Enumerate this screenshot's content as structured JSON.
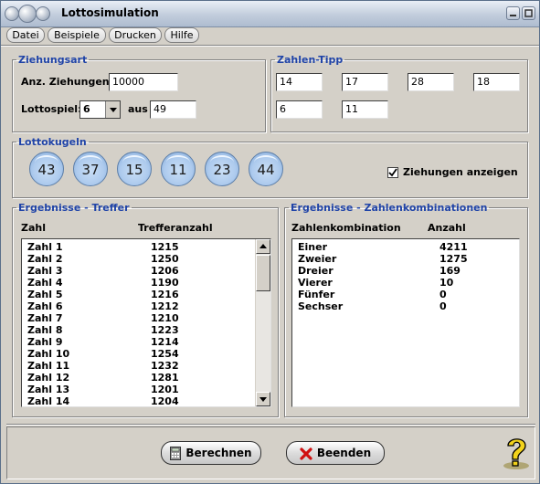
{
  "window": {
    "title": "Lottosimulation"
  },
  "menu": {
    "items": [
      "Datei",
      "Beispiele",
      "Drucken",
      "Hilfe"
    ]
  },
  "ziehungsart": {
    "legend": "Ziehungsart",
    "anz_label": "Anz. Ziehungen:",
    "anz_value": "10000",
    "lottospiel_label": "Lottospiel:",
    "lottospiel_value": "6",
    "aus_label": "aus",
    "aus_value": "49"
  },
  "tipp": {
    "legend": "Zahlen-Tipp",
    "values": [
      "14",
      "17",
      "28",
      "18",
      "6",
      "11"
    ]
  },
  "kugeln": {
    "legend": "Lottokugeln",
    "balls": [
      "43",
      "37",
      "15",
      "11",
      "23",
      "44"
    ],
    "show_label": "Ziehungen anzeigen",
    "show_checked": true
  },
  "treffer": {
    "legend": "Ergebnisse - Treffer",
    "col1": "Zahl",
    "col2": "Trefferanzahl",
    "rows": [
      [
        "Zahl 1",
        "1215"
      ],
      [
        "Zahl 2",
        "1250"
      ],
      [
        "Zahl 3",
        "1206"
      ],
      [
        "Zahl 4",
        "1190"
      ],
      [
        "Zahl 5",
        "1216"
      ],
      [
        "Zahl 6",
        "1212"
      ],
      [
        "Zahl 7",
        "1210"
      ],
      [
        "Zahl 8",
        "1223"
      ],
      [
        "Zahl 9",
        "1214"
      ],
      [
        "Zahl 10",
        "1254"
      ],
      [
        "Zahl 11",
        "1232"
      ],
      [
        "Zahl 12",
        "1281"
      ],
      [
        "Zahl 13",
        "1201"
      ],
      [
        "Zahl 14",
        "1204"
      ]
    ]
  },
  "kombi": {
    "legend": "Ergebnisse - Zahlenkombinationen",
    "col1": "Zahlenkombination",
    "col2": "Anzahl",
    "rows": [
      [
        "Einer",
        "4211"
      ],
      [
        "Zweier",
        "1275"
      ],
      [
        "Dreier",
        "169"
      ],
      [
        "Vierer",
        "10"
      ],
      [
        "Fünfer",
        "0"
      ],
      [
        "Sechser",
        "0"
      ]
    ]
  },
  "buttons": {
    "berechnen": "Berechnen",
    "beenden": "Beenden"
  },
  "colors": {
    "legend": "#2044a8",
    "ball": "#aecbee",
    "face": "#d4d0c8"
  }
}
